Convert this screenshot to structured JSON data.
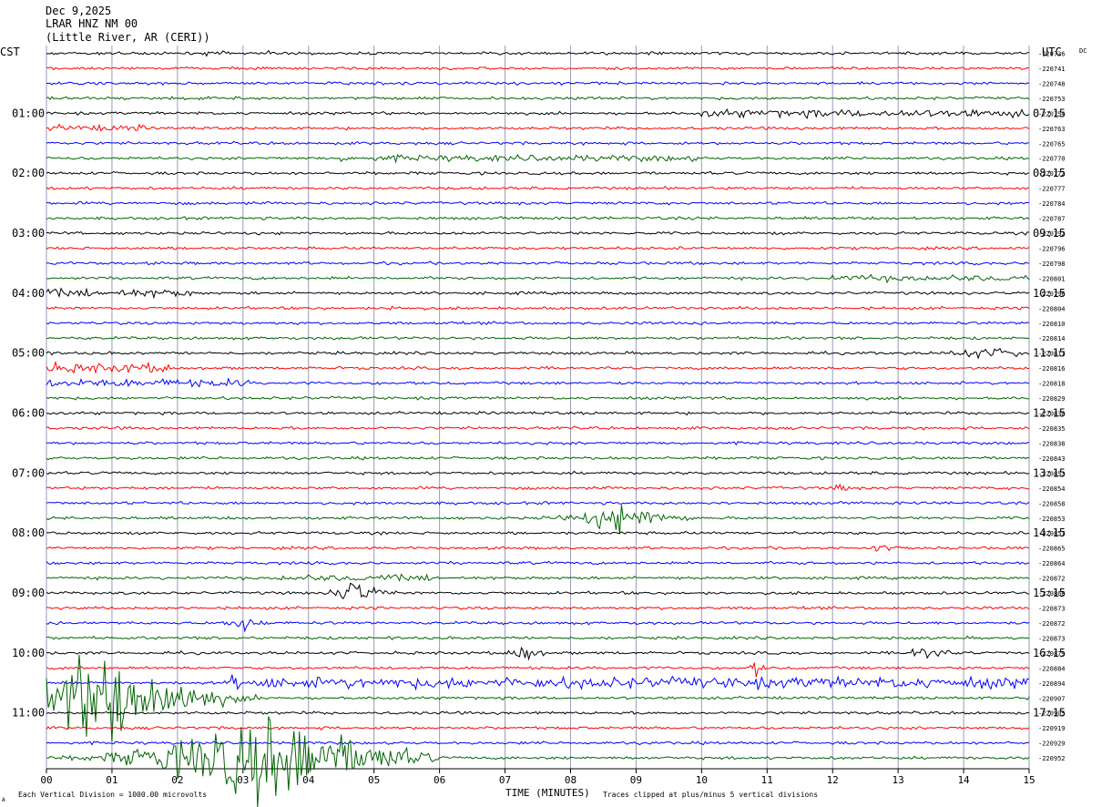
{
  "header": {
    "date": "Dec 9,2025",
    "station": "LRAR HNZ NM 00",
    "location": "(Little River, AR (CERI))"
  },
  "left_zone": "CST",
  "right_zone": "UTC",
  "dc_label": "DC",
  "footer": {
    "xlabel": "TIME (MINUTES)",
    "scale_note": "Each Vertical Division = 1000.00 microvolts",
    "clip_note": "Traces clipped at plus/minus 5 vertical divisions",
    "corner_mark": "A"
  },
  "colors": {
    "trace_cycle": [
      "#000000",
      "#ff0000",
      "#0000ff",
      "#006400"
    ],
    "grid": "#9a9ab8",
    "axis": "#000000"
  },
  "chart_data": {
    "type": "line",
    "subtype": "helicorder",
    "title": "LRAR HNZ NM 00",
    "xlabel": "TIME (MINUTES)",
    "xlim": [
      0,
      15
    ],
    "x_ticks": [
      "00",
      "01",
      "02",
      "03",
      "04",
      "05",
      "06",
      "07",
      "08",
      "09",
      "10",
      "11",
      "12",
      "13",
      "14",
      "15"
    ],
    "rows": 48,
    "minutes_per_row": 15,
    "left_time_labels": [
      {
        "row": 4,
        "label": "01:00"
      },
      {
        "row": 8,
        "label": "02:00"
      },
      {
        "row": 12,
        "label": "03:00"
      },
      {
        "row": 16,
        "label": "04:00"
      },
      {
        "row": 20,
        "label": "05:00"
      },
      {
        "row": 24,
        "label": "06:00"
      },
      {
        "row": 28,
        "label": "07:00"
      },
      {
        "row": 32,
        "label": "08:00"
      },
      {
        "row": 36,
        "label": "09:00"
      },
      {
        "row": 40,
        "label": "10:00"
      },
      {
        "row": 44,
        "label": "11:00"
      }
    ],
    "right_time_labels": [
      {
        "row": 4,
        "label": "07:15"
      },
      {
        "row": 8,
        "label": "08:15"
      },
      {
        "row": 12,
        "label": "09:15"
      },
      {
        "row": 16,
        "label": "10:15"
      },
      {
        "row": 20,
        "label": "11:15"
      },
      {
        "row": 24,
        "label": "12:15"
      },
      {
        "row": 28,
        "label": "13:15"
      },
      {
        "row": 32,
        "label": "14:15"
      },
      {
        "row": 36,
        "label": "15:15"
      },
      {
        "row": 40,
        "label": "16:15"
      },
      {
        "row": 44,
        "label": "17:15"
      }
    ],
    "dc_offsets": [
      "-220736",
      "-220741",
      "-220748",
      "-220753",
      "-220754",
      "-220763",
      "-220765",
      "-220770",
      "-220772",
      "-220777",
      "-220784",
      "-220787",
      "-220792",
      "-220796",
      "-220798",
      "-220801",
      "-220796",
      "-220804",
      "-220810",
      "-220814",
      "-220817",
      "-220816",
      "-220818",
      "-220829",
      "-220830",
      "-220835",
      "-220838",
      "-220843",
      "-220853",
      "-220854",
      "-220858",
      "-220853",
      "-220857",
      "-220865",
      "-220864",
      "-220872",
      "-220868",
      "-220873",
      "-220872",
      "-220873",
      "-220879",
      "-220884",
      "-220894",
      "-220907",
      "-220905",
      "-220919",
      "-220929",
      "-220952"
    ],
    "events": [
      {
        "row": 0,
        "start": 0,
        "end": 4.2,
        "amp": 0.8,
        "kind": "spikes"
      },
      {
        "row": 4,
        "start": 10,
        "end": 15,
        "amp": 2.5
      },
      {
        "row": 5,
        "start": 0,
        "end": 1.5,
        "amp": 2
      },
      {
        "row": 7,
        "start": 4.5,
        "end": 10,
        "amp": 2
      },
      {
        "row": 15,
        "start": 12,
        "end": 15,
        "amp": 2
      },
      {
        "row": 16,
        "start": 0,
        "end": 2.2,
        "amp": 2.5
      },
      {
        "row": 17,
        "start": 5.2,
        "end": 5.4,
        "amp": 3
      },
      {
        "row": 20,
        "start": 13.8,
        "end": 15,
        "amp": 3
      },
      {
        "row": 21,
        "start": 0,
        "end": 1.9,
        "amp": 3
      },
      {
        "row": 22,
        "start": 0,
        "end": 3.1,
        "amp": 2.5
      },
      {
        "row": 29,
        "start": 12,
        "end": 12.3,
        "amp": 2.5
      },
      {
        "row": 31,
        "start": 7.5,
        "end": 9.9,
        "amp": 9,
        "peak": 8.8
      },
      {
        "row": 33,
        "start": 12.6,
        "end": 12.9,
        "amp": 2.5
      },
      {
        "row": 35,
        "start": 3.5,
        "end": 6,
        "amp": 2
      },
      {
        "row": 36,
        "start": 4.3,
        "end": 5.4,
        "amp": 8,
        "peak": 4.7
      },
      {
        "row": 38,
        "start": 2.6,
        "end": 3.4,
        "amp": 5,
        "peak": 3
      },
      {
        "row": 40,
        "start": 7,
        "end": 7.7,
        "amp": 6,
        "peak": 7.3
      },
      {
        "row": 40,
        "start": 13.2,
        "end": 13.9,
        "amp": 6,
        "peak": 13.4
      },
      {
        "row": 41,
        "start": 10.7,
        "end": 11,
        "amp": 6,
        "peak": 10.85
      },
      {
        "row": 42,
        "start": 2.7,
        "end": 3.2,
        "amp": 6,
        "peak": 2.9
      },
      {
        "row": 42,
        "start": 3.2,
        "end": 15,
        "amp": 3.5
      },
      {
        "row": 43,
        "start": 0,
        "end": 3.5,
        "amp": 32,
        "peak": 0.9
      },
      {
        "row": 47,
        "start": 0,
        "end": 6,
        "amp": 30,
        "peak": 3.4
      }
    ]
  }
}
